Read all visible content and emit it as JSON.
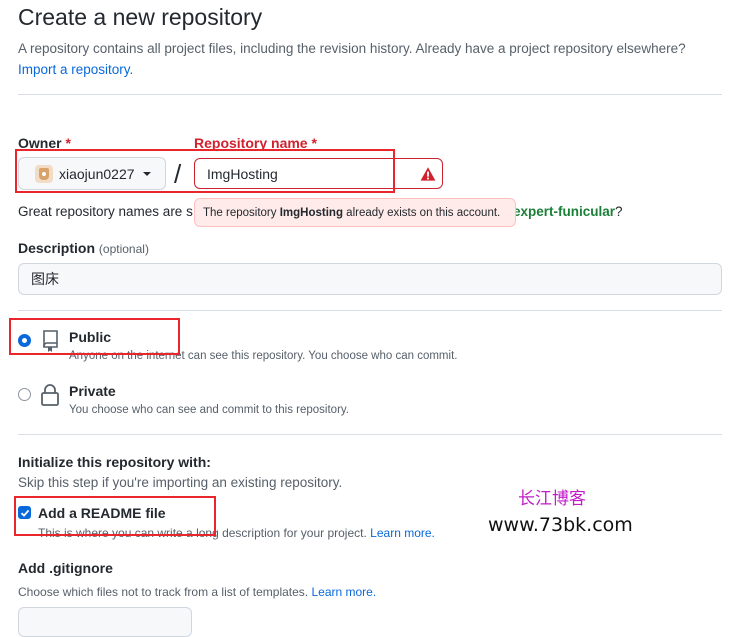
{
  "page": {
    "title": "Create a new repository",
    "subtitle": "A repository contains all project files, including the revision history. Already have a project repository elsewhere?",
    "import_link": "Import a repository."
  },
  "owner": {
    "label": "Owner",
    "required_mark": "*",
    "value": "xiaojun0227",
    "icon": "avatar"
  },
  "separator": "/",
  "repo_name": {
    "label": "Repository name",
    "required_mark": "*",
    "value": "ImgHosting",
    "error_icon": "alert-icon",
    "error_prefix": "The repository",
    "error_name": "ImgHosting",
    "error_suffix": "already exists on this account."
  },
  "hint": {
    "prefix": "Great repository names are s",
    "suggestion": "expert-funicular",
    "suffix": "?"
  },
  "description": {
    "label": "Description",
    "optional": "(optional)",
    "value": "图床"
  },
  "visibility": {
    "public": {
      "title": "Public",
      "desc": "Anyone on the internet can see this repository. You choose who can commit.",
      "icon": "repo-icon",
      "selected": true
    },
    "private": {
      "title": "Private",
      "desc": "You choose who can see and commit to this repository.",
      "icon": "lock-icon",
      "selected": false
    }
  },
  "initialize": {
    "title": "Initialize this repository with:",
    "desc": "Skip this step if you're importing an existing repository.",
    "readme": {
      "label": "Add a README file",
      "desc": "This is where you can write a long description for your project.",
      "learn_more": "Learn more.",
      "checked": true
    }
  },
  "gitignore": {
    "title": "Add .gitignore",
    "desc": "Choose which files not to track from a list of templates.",
    "learn_more": "Learn more."
  },
  "watermark": {
    "line1": "长江博客",
    "line2": "www.73bk.com"
  },
  "colors": {
    "accent": "#0969da",
    "danger": "#cf222e",
    "success": "#1a7f37",
    "highlight_box": "#e8262c",
    "watermark": "#c21cc9"
  }
}
